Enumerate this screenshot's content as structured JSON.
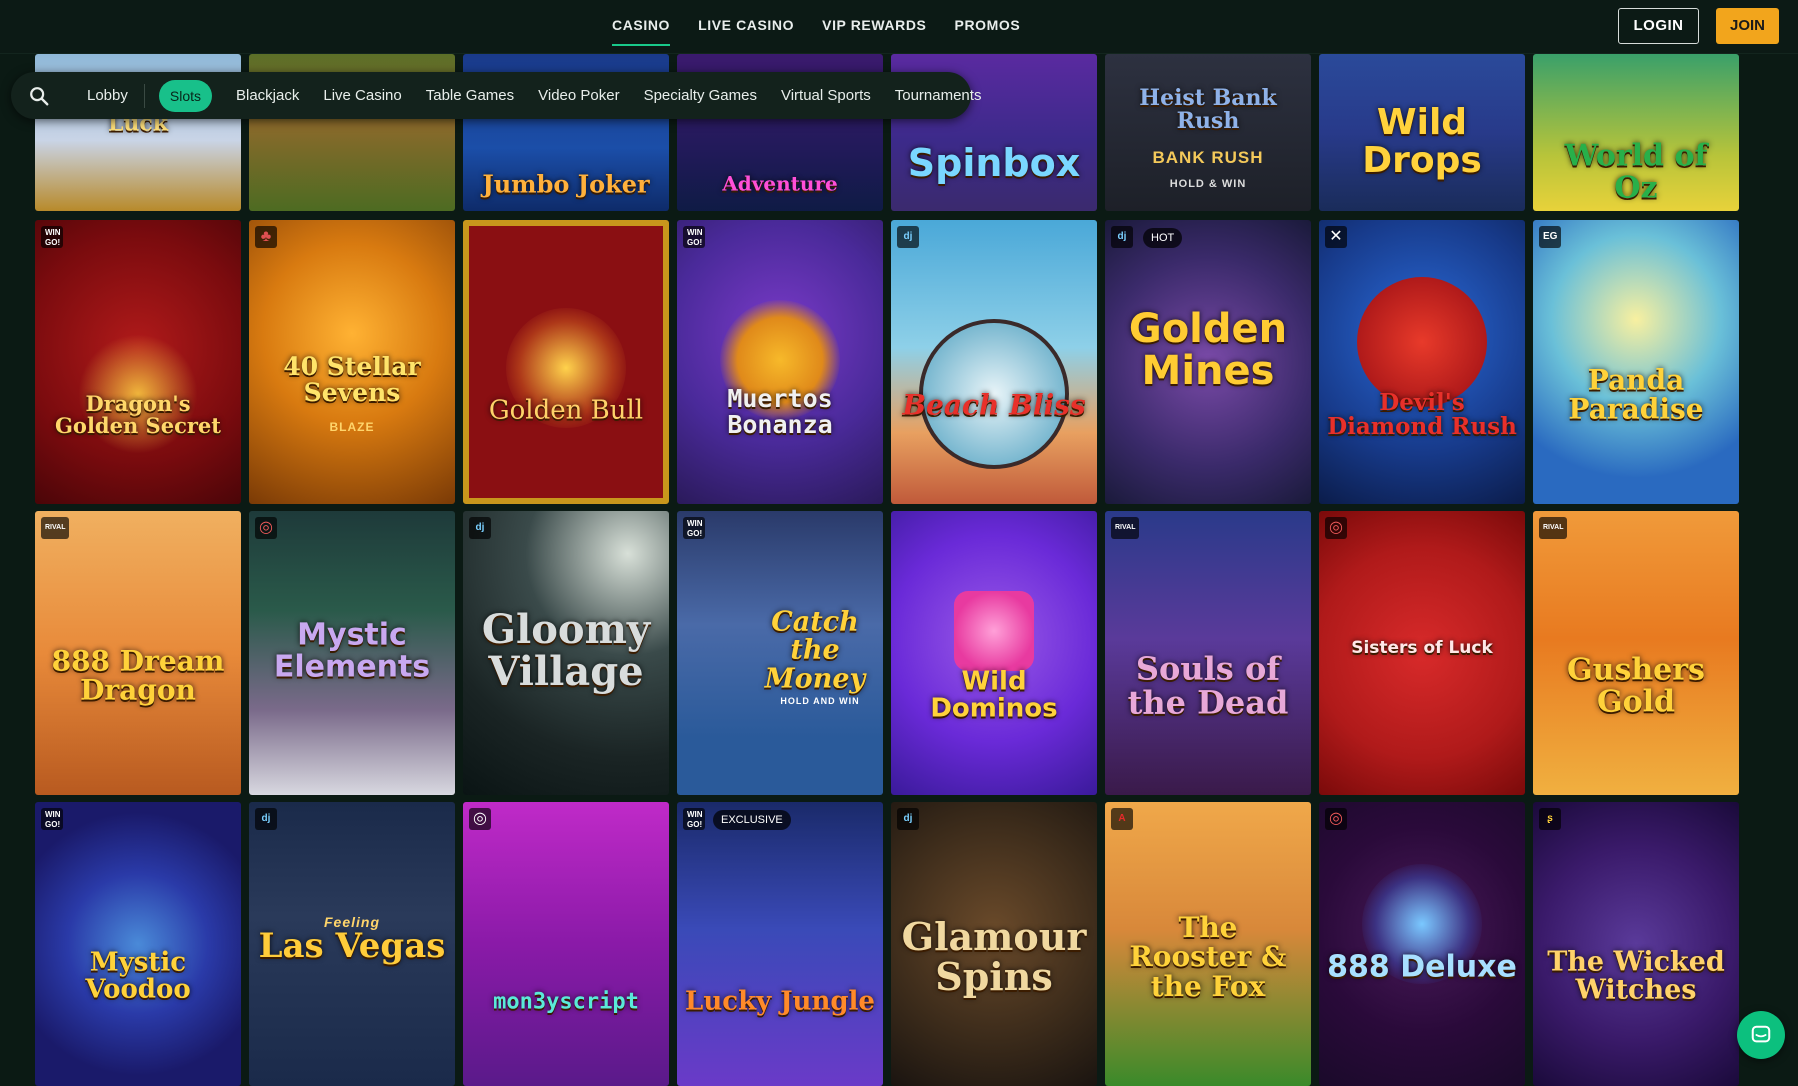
{
  "topnav": {
    "casino": "CASINO",
    "live_casino": "LIVE CASINO",
    "vip_rewards": "VIP REWARDS",
    "promos": "PROMOS"
  },
  "auth": {
    "login": "LOGIN",
    "join": "JOIN"
  },
  "filters": {
    "lobby": "Lobby",
    "slots": "Slots",
    "blackjack": "Blackjack",
    "live_casino": "Live Casino",
    "table_games": "Table Games",
    "video_poker": "Video Poker",
    "specialty_games": "Specialty Games",
    "virtual_sports": "Virtual Sports",
    "tournaments": "Tournaments"
  },
  "games": {
    "r0": [
      "Luck",
      "",
      "Jumbo Joker",
      "Adventure",
      "Spinbox",
      "Heist Bank Rush",
      "Wild Drops",
      "World of Oz"
    ],
    "r0_sub": {
      "heist": "BANK RUSH",
      "heist2": "HOLD & WIN"
    },
    "r1": [
      "Dragon's Golden Secret",
      "40 Stellar Sevens",
      "Golden Bull",
      "Muertos Bonanza",
      "Beach Bliss",
      "Golden Mines",
      "Devil's Diamond Rush",
      "Panda Paradise"
    ],
    "r1_sub": {
      "stellar": "BLAZE"
    },
    "r2": [
      "888 Dream Dragon",
      "Mystic Elements",
      "Gloomy Village",
      "Catch the Money",
      "Wild Dominos",
      "Souls of the Dead",
      "Sisters of Luck",
      "Gushers Gold"
    ],
    "r2_sub": {
      "catch": "HOLD AND WIN"
    },
    "r3": [
      "Mystic Voodoo",
      "Las Vegas",
      "mon3yscript",
      "Lucky Jungle",
      "Glamour Spins",
      "The Rooster & the Fox",
      "888 Deluxe",
      "The Wicked Witches"
    ],
    "r3_sub": {
      "vegas": "Feeling"
    }
  },
  "badges": {
    "wingo": "WIN GO!",
    "rival": "RIVAL",
    "eg": "EG",
    "hot": "HOT",
    "exclusive": "EXCLUSIVE"
  }
}
